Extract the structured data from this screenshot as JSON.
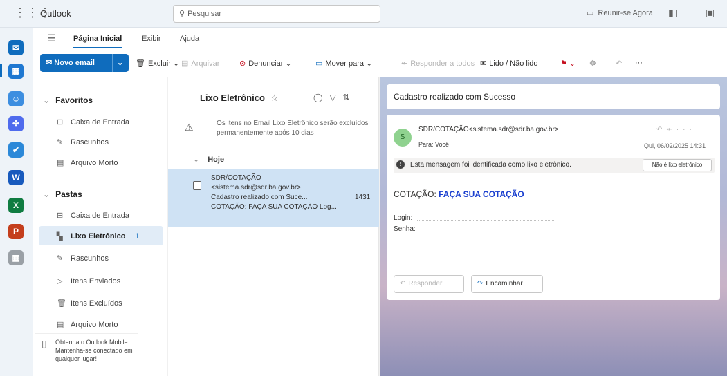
{
  "topbar": {
    "app_title": "Outlook",
    "search_placeholder": "Pesquisar",
    "meet_now": "Reunir-se Agora"
  },
  "ribbon": {
    "tabs": [
      "Página Inicial",
      "Exibir",
      "Ajuda"
    ],
    "active_tab": "Página Inicial",
    "new_email": "Novo email",
    "tools": {
      "delete": "Excluir",
      "archive": "Arquivar",
      "report": "Denunciar",
      "move": "Mover para",
      "reply_all": "Responder a todos",
      "read_unread": "Lido / Não lido"
    }
  },
  "folders": {
    "favorites_header": "Favoritos",
    "favorites": [
      {
        "label": "Caixa de Entrada",
        "icon": "inbox-icon"
      },
      {
        "label": "Rascunhos",
        "icon": "drafts-icon"
      },
      {
        "label": "Arquivo Morto",
        "icon": "archive-icon"
      }
    ],
    "folders_header": "Pastas",
    "folders": [
      {
        "label": "Caixa de Entrada",
        "icon": "inbox-icon"
      },
      {
        "label": "Lixo Eletrônico",
        "icon": "junk-icon",
        "count": "1",
        "selected": true
      },
      {
        "label": "Rascunhos",
        "icon": "drafts-icon"
      },
      {
        "label": "Itens Enviados",
        "icon": "sent-icon"
      },
      {
        "label": "Itens Excluídos",
        "icon": "trash-icon"
      },
      {
        "label": "Arquivo Morto",
        "icon": "archive-icon"
      }
    ],
    "promo": "Obtenha o Outlook Mobile. Mantenha-se conectado em qualquer lugar!"
  },
  "list": {
    "title": "Lixo Eletrônico",
    "notice": "Os itens no Email Lixo Eletrônico serão excluídos permanentemente após 10 dias",
    "group": "Hoje",
    "message": {
      "from": "SDR/COTAÇÃO",
      "email": "<sistema.sdr@sdr.ba.gov.br>",
      "subject": "Cadastro realizado com Suce...",
      "time": "1431",
      "preview": "COTAÇÃO: FAÇA SUA COTAÇÃO Log..."
    }
  },
  "reading": {
    "subject": "Cadastro realizado com Sucesso",
    "avatar": "S",
    "sender": "SDR/COTAÇÃO<sistema.sdr@sdr.ba.gov.br>",
    "to": "Para: Você",
    "date": "Qui, 06/02/2025 14:31",
    "junk_notice": "Esta mensagem foi identificada como lixo eletrônico.",
    "not_junk": "Não é lixo eletrônico",
    "body_prefix": "COTAÇÃO:",
    "body_link": "FAÇA SUA COTAÇÃO",
    "login_label": "Login:",
    "senha_label": "Senha:",
    "reply": "Responder",
    "forward": "Encaminhar"
  }
}
